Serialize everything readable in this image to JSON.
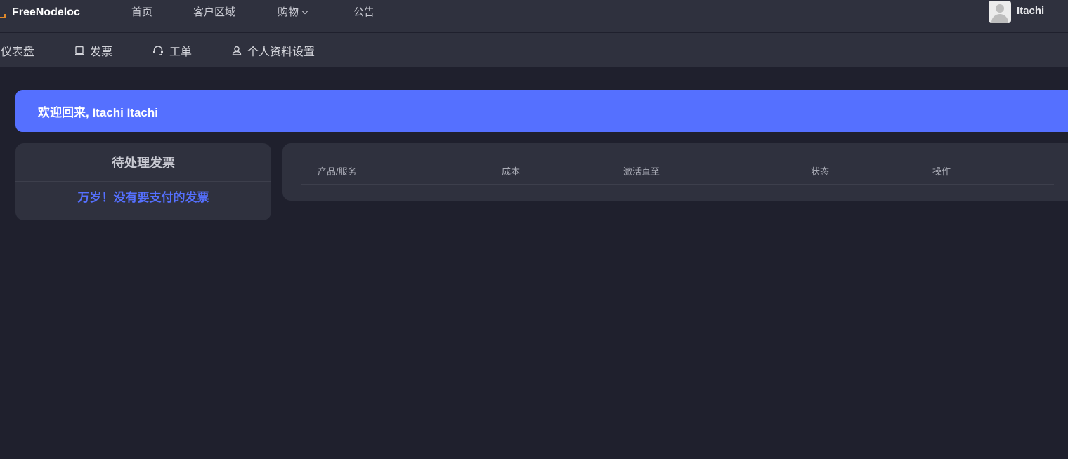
{
  "brand": {
    "name": "FreeNodeloc"
  },
  "topnav": [
    {
      "label": "首页"
    },
    {
      "label": "客户区域"
    },
    {
      "label": "购物"
    },
    {
      "label": "公告"
    }
  ],
  "user": {
    "name": "Itachi"
  },
  "subnav": [
    {
      "label": "仪表盘",
      "icon": "dashboard-icon"
    },
    {
      "label": "发票",
      "icon": "invoice-icon"
    },
    {
      "label": "工单",
      "icon": "headset-icon"
    },
    {
      "label": "个人资料设置",
      "icon": "user-icon"
    }
  ],
  "welcome": {
    "text": "欢迎回来, Itachi Itachi"
  },
  "invoices": {
    "title": "待处理发票",
    "empty_message": "万岁！没有要支付的发票"
  },
  "services_table": {
    "columns": [
      "产品/服务",
      "成本",
      "激活直至",
      "状态",
      "操作"
    ],
    "rows": []
  },
  "colors": {
    "accent": "#5570ff",
    "background": "#1f202d",
    "panel": "#2f313e",
    "brand_logo": "#e0892a"
  }
}
